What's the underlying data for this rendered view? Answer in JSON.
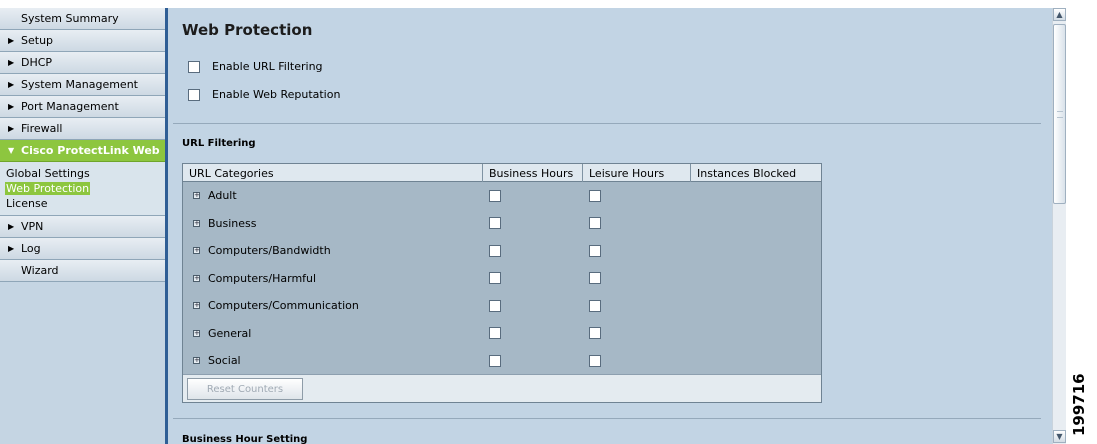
{
  "sidebar": {
    "items": [
      {
        "label": "System Summary",
        "arrow": ""
      },
      {
        "label": "Setup",
        "arrow": "▶"
      },
      {
        "label": "DHCP",
        "arrow": "▶"
      },
      {
        "label": "System Management",
        "arrow": "▶"
      },
      {
        "label": "Port Management",
        "arrow": "▶"
      },
      {
        "label": "Firewall",
        "arrow": "▶"
      },
      {
        "label": "Cisco ProtectLink Web",
        "arrow": "▼"
      },
      {
        "label": "VPN",
        "arrow": "▶"
      },
      {
        "label": "Log",
        "arrow": "▶"
      },
      {
        "label": "Wizard",
        "arrow": ""
      }
    ],
    "sub_items": [
      {
        "label": "Global Settings"
      },
      {
        "label": "Web Protection"
      },
      {
        "label": "License"
      }
    ]
  },
  "main": {
    "title": "Web Protection",
    "enable_url_filtering": "Enable URL Filtering",
    "enable_web_reputation": "Enable Web Reputation",
    "url_filtering_section": "URL Filtering",
    "business_hour_section": "Business Hour Setting",
    "table": {
      "headers": [
        "URL Categories",
        "Business Hours",
        "Leisure Hours",
        "Instances Blocked"
      ],
      "rows": [
        {
          "category": "Adult"
        },
        {
          "category": "Business"
        },
        {
          "category": "Computers/Bandwidth"
        },
        {
          "category": "Computers/Harmful"
        },
        {
          "category": "Computers/Communication"
        },
        {
          "category": "General"
        },
        {
          "category": "Social"
        }
      ],
      "reset_label": "Reset Counters"
    }
  },
  "figure_id": "199716",
  "colors": {
    "accent_green": "#8dc63f",
    "content_bg": "#c2d4e4",
    "sidebar_divider": "#2f5e95"
  }
}
